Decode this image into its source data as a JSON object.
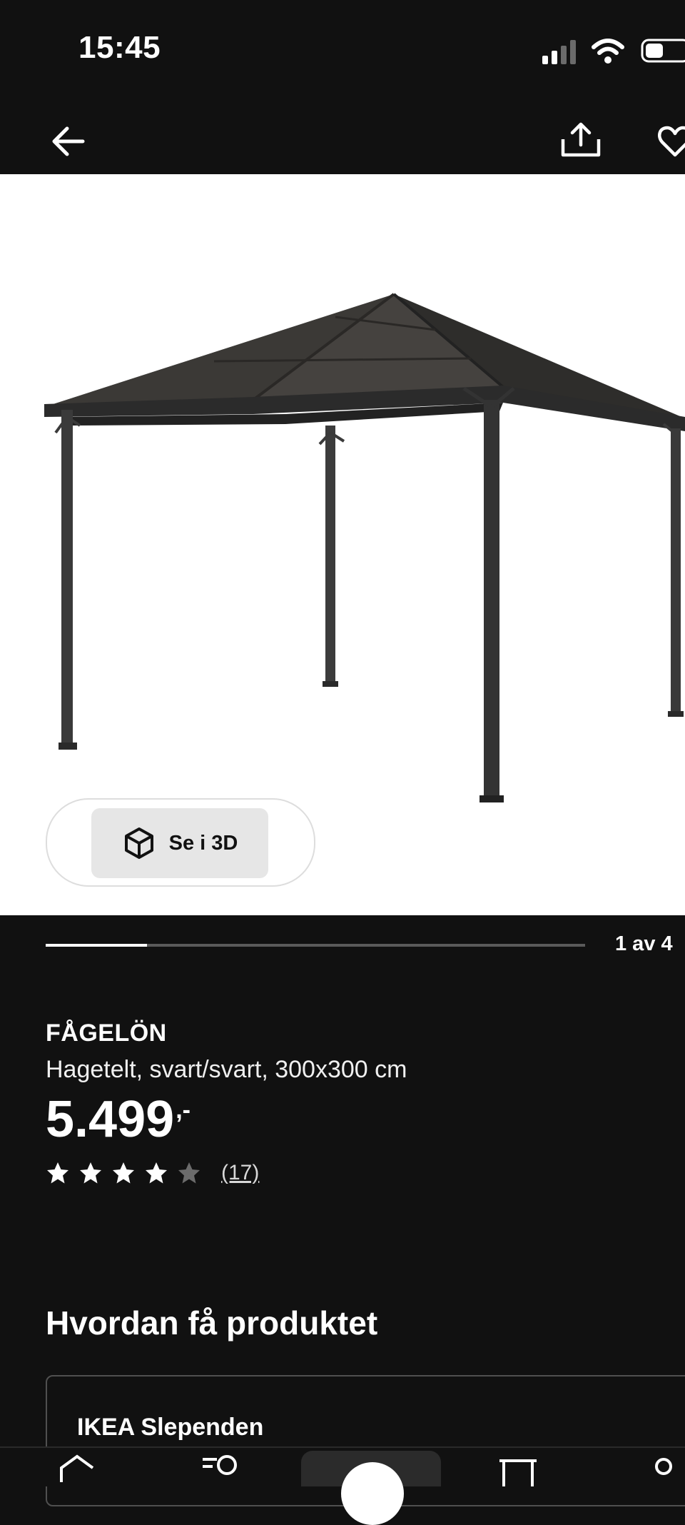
{
  "status": {
    "time": "15:45"
  },
  "nav": {
    "back_icon": "arrow-left-icon",
    "share_icon": "share-icon",
    "favorite_icon": "heart-icon"
  },
  "hero": {
    "see3d_label": "Se i 3D",
    "image_icon": "gazebo-image"
  },
  "carousel": {
    "counter": "1 av 4",
    "progress": 0.25
  },
  "product": {
    "name": "FÅGELÖN",
    "description": "Hagetelt, svart/svart, 300x300 cm",
    "price_int": "5.499",
    "price_dec": ",-",
    "rating": 4,
    "rating_max": 5,
    "review_count": "(17)"
  },
  "availability": {
    "title": "Hvordan få produktet",
    "store_name": "IKEA Slependen"
  },
  "colors": {
    "background": "#111111",
    "hero_background": "#ffffff",
    "text": "#ffffff"
  }
}
